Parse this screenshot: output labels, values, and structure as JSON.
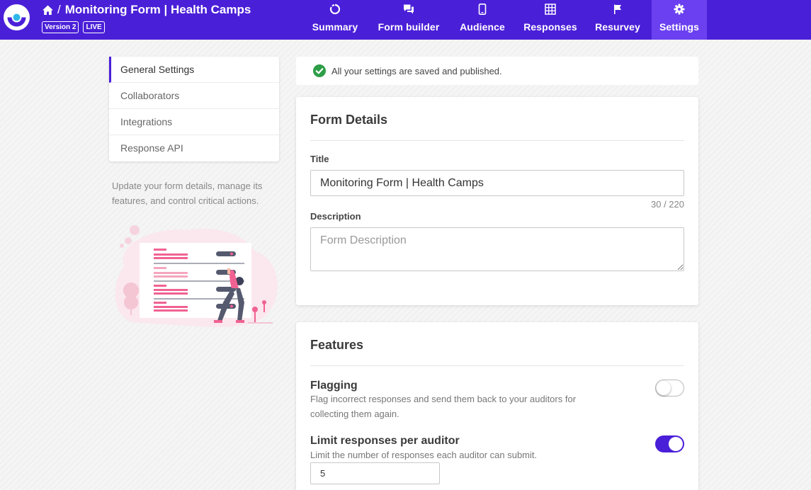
{
  "header": {
    "form_title": "Monitoring Form | Health Camps",
    "separator": "/",
    "version_badge": "Version 2",
    "status_badge": "LIVE",
    "brand_color": "#4a1fd8",
    "nav": [
      {
        "label": "Summary",
        "icon": "donut-chart-icon"
      },
      {
        "label": "Form builder",
        "icon": "chat-bubbles-icon"
      },
      {
        "label": "Audience",
        "icon": "mobile-phone-icon"
      },
      {
        "label": "Responses",
        "icon": "table-grid-icon"
      },
      {
        "label": "Resurvey",
        "icon": "flag-icon"
      },
      {
        "label": "Settings",
        "icon": "gear-icon",
        "active": true
      }
    ]
  },
  "sidebar": {
    "items": [
      {
        "label": "General Settings",
        "active": true
      },
      {
        "label": "Collaborators"
      },
      {
        "label": "Integrations"
      },
      {
        "label": "Response API"
      }
    ],
    "description": "Update your form details, manage its features, and control critical actions."
  },
  "notice": {
    "text": "All your settings are saved and published.",
    "icon": "check-circle-icon",
    "color": "#2e9e48"
  },
  "form_details": {
    "heading": "Form Details",
    "title_label": "Title",
    "title_value": "Monitoring Form | Health Camps",
    "title_counter": "30 / 220",
    "description_label": "Description",
    "description_placeholder": "Form Description"
  },
  "features": {
    "heading": "Features",
    "flagging": {
      "title": "Flagging",
      "desc": "Flag incorrect responses and send them back to your auditors for collecting them again.",
      "enabled": false
    },
    "limit_responses": {
      "title": "Limit responses per auditor",
      "desc": "Limit the number of responses each auditor can submit.",
      "enabled": true,
      "value": "5"
    }
  }
}
